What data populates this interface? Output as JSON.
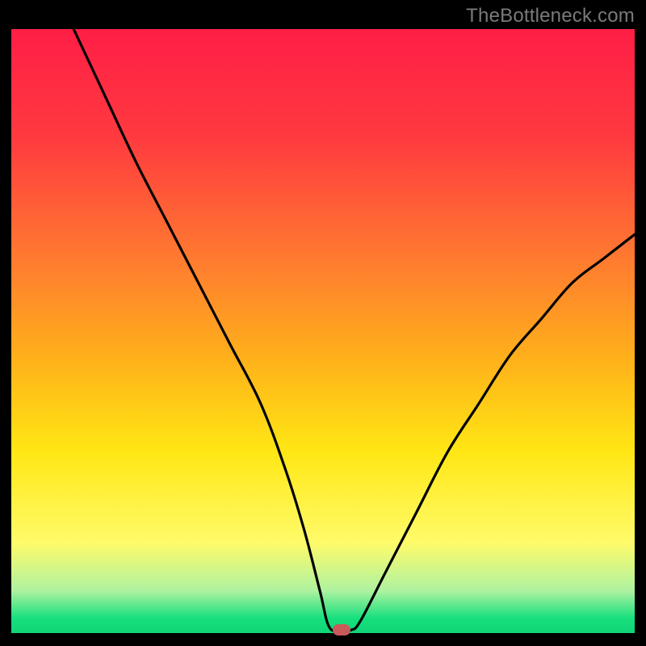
{
  "watermark": "TheBottleneck.com",
  "chart_data": {
    "type": "line",
    "title": "",
    "xlabel": "",
    "ylabel": "",
    "xlim": [
      0,
      100
    ],
    "ylim": [
      0,
      100
    ],
    "grid": false,
    "legend": false,
    "background_gradient": {
      "stops": [
        {
          "pos": 0.0,
          "color": "#ff1e46"
        },
        {
          "pos": 0.18,
          "color": "#ff3a3f"
        },
        {
          "pos": 0.38,
          "color": "#ff7a30"
        },
        {
          "pos": 0.55,
          "color": "#ffb21a"
        },
        {
          "pos": 0.7,
          "color": "#ffe714"
        },
        {
          "pos": 0.85,
          "color": "#fffb6a"
        },
        {
          "pos": 0.93,
          "color": "#aef2a0"
        },
        {
          "pos": 0.975,
          "color": "#18e07e"
        },
        {
          "pos": 1.0,
          "color": "#0fd477"
        }
      ]
    },
    "series": [
      {
        "name": "bottleneck-curve",
        "x": [
          10,
          15,
          20,
          25,
          30,
          35,
          40,
          44,
          47,
          49.5,
          51,
          53,
          54.5,
          56,
          60,
          65,
          70,
          75,
          80,
          85,
          90,
          95,
          100
        ],
        "y": [
          100,
          89,
          78,
          68,
          58,
          48,
          38,
          27,
          17,
          7,
          1,
          0.5,
          0.5,
          2,
          10,
          20,
          30,
          38,
          46,
          52,
          58,
          62,
          66
        ]
      }
    ],
    "marker": {
      "x": 53,
      "y": 0.5
    }
  }
}
